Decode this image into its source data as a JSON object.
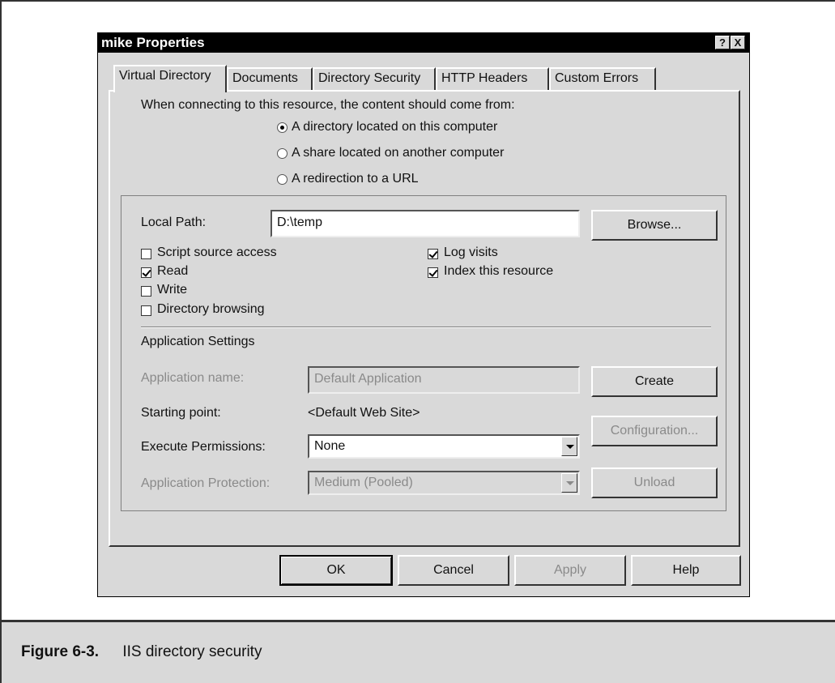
{
  "dialog": {
    "title": "mike Properties",
    "help_glyph": "?",
    "close_glyph": "X"
  },
  "tabs": [
    {
      "label": "Virtual Directory",
      "active": true
    },
    {
      "label": "Documents"
    },
    {
      "label": "Directory Security"
    },
    {
      "label": "HTTP Headers"
    },
    {
      "label": "Custom Errors"
    }
  ],
  "content_source": {
    "prompt": "When connecting to this resource, the content should come from:",
    "options": [
      {
        "label": "A directory located on this computer",
        "checked": true
      },
      {
        "label": "A share located on another computer",
        "checked": false
      },
      {
        "label": "A redirection to a URL",
        "checked": false
      }
    ]
  },
  "local_path": {
    "label": "Local Path:",
    "value": "D:\\temp",
    "browse_label": "Browse..."
  },
  "permissions": {
    "left": [
      {
        "label": "Script source access",
        "checked": false
      },
      {
        "label": "Read",
        "checked": true
      },
      {
        "label": "Write",
        "checked": false
      },
      {
        "label": "Directory browsing",
        "checked": false
      }
    ],
    "right": [
      {
        "label": "Log visits",
        "checked": true
      },
      {
        "label": "Index this resource",
        "checked": true
      }
    ]
  },
  "app_settings": {
    "heading": "Application Settings",
    "name_label": "Application name:",
    "name_value": "Default Application",
    "create_label": "Create",
    "start_label": "Starting point:",
    "start_value": "<Default Web Site>",
    "config_label": "Configuration...",
    "exec_label": "Execute Permissions:",
    "exec_value": "None",
    "protect_label": "Application Protection:",
    "protect_value": "Medium (Pooled)",
    "unload_label": "Unload"
  },
  "footer": {
    "ok": "OK",
    "cancel": "Cancel",
    "apply": "Apply",
    "help": "Help"
  },
  "caption": {
    "number": "Figure 6-3.",
    "text": "IIS directory security"
  }
}
